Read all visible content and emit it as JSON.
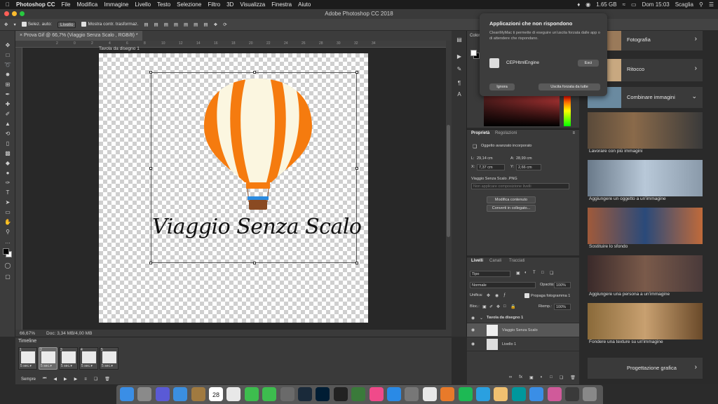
{
  "menubar": {
    "app_name": "Photoshop CC",
    "items": [
      "File",
      "Modifica",
      "Immagine",
      "Livello",
      "Testo",
      "Selezione",
      "Filtro",
      "3D",
      "Visualizza",
      "Finestra",
      "Aiuto"
    ],
    "battery": "1.65 GB",
    "clock": "Dom 15:03",
    "user": "Scaglia"
  },
  "window": {
    "title": "Adobe Photoshop CC 2018"
  },
  "options_bar": {
    "auto_select_label": "Selez. auto:",
    "auto_select_value": "Livello",
    "transform_label": "Mostra contr. trasformaz."
  },
  "document": {
    "tab_title": "Prova Gif @ 66,7% (Viaggio Senza Scalo , RGB/8) *",
    "artboard_label": "Tavola da disegno 1",
    "wordmark": "Viaggio Senza Scalo",
    "zoom": "66,67%",
    "doc_info": "Doc: 3,34 MB/4,00 MB"
  },
  "ruler_marks": [
    "2",
    "0",
    "2",
    "4",
    "6",
    "8",
    "10",
    "12",
    "14",
    "16",
    "18",
    "20",
    "22",
    "24",
    "26",
    "28",
    "30",
    "32",
    "34"
  ],
  "timeline": {
    "title": "Timeline",
    "frames": [
      {
        "num": "1",
        "delay": "5 sec.▾",
        "selected": false
      },
      {
        "num": "2",
        "delay": "5 sec.▾",
        "selected": true
      },
      {
        "num": "3",
        "delay": "5 sec.▾",
        "selected": false
      },
      {
        "num": "4",
        "delay": "5 sec.▾",
        "selected": false
      },
      {
        "num": "5",
        "delay": "5 sec.▾",
        "selected": false
      }
    ],
    "loop": "Sempre"
  },
  "color_panel": {
    "title": "Colore"
  },
  "properties": {
    "tab1": "Proprietà",
    "tab2": "Regolazioni",
    "type_label": "Oggetto avanzato incorporato",
    "l_label": "L:",
    "l_value": "29,14 cm",
    "a_label": "A:",
    "a_value": "28,99 cm",
    "x_label": "X:",
    "x_value": "7,37 cm",
    "y_label": "Y:",
    "y_value": "2,66 cm",
    "file_name": "Viaggio Senza Scalo .PNG",
    "comp_placeholder": "Non applicare composizione livelli",
    "btn_edit": "Modifica contenuto",
    "btn_convert": "Converti in collegato..."
  },
  "layers_panel": {
    "tabs": [
      "Livelli",
      "Canali",
      "Tracciati"
    ],
    "filter_label": "Tipo",
    "blend_mode": "Normale",
    "opacity_label": "Opacità:",
    "opacity_value": "100%",
    "unify_label": "Unifica:",
    "propagate_label": "Propaga fotogramma 1",
    "lock_label": "Bloc.:",
    "fill_label": "Riemp.:",
    "fill_value": "100%",
    "layers": [
      {
        "name": "Tavola da disegno 1",
        "type": "group"
      },
      {
        "name": "Viaggio Senza Scalo",
        "type": "smart",
        "active": true
      },
      {
        "name": "Livello 1",
        "type": "pixel"
      }
    ]
  },
  "learn_panel": {
    "top_rows": [
      "Fotografia",
      "Ritocco"
    ],
    "section_title": "Combinare immagini",
    "cards": [
      "Lavorare con più immagini",
      "Aggiungere un oggetto a un'immagine",
      "Sostituire lo sfondo",
      "Aggiungere una persona a un'immagine",
      "Fondere una texture su un'immagine"
    ],
    "bottom_row": "Progettazione grafica"
  },
  "notification": {
    "title": "Applicazioni che non rispondono",
    "body": "CleanMyMac ti permette di eseguire un'uscita forzata dalle app o di attendere che rispondano.",
    "app_name": "CEPHtmlEngine",
    "btn_quit": "Esci",
    "btn_ignore": "Ignora",
    "btn_force_all": "Uscita forzata da tutte"
  },
  "dock": {
    "calendar_day": "28",
    "apps": [
      {
        "name": "finder",
        "color": "#3a8ee6"
      },
      {
        "name": "launchpad",
        "color": "#8a8a8a"
      },
      {
        "name": "siri",
        "color": "#5a5ad6"
      },
      {
        "name": "mail",
        "color": "#3b8fe0"
      },
      {
        "name": "notes",
        "color": "#a07a40"
      },
      {
        "name": "calendar",
        "color": "#ffffff"
      },
      {
        "name": "photos",
        "color": "#e8e8e8"
      },
      {
        "name": "messages",
        "color": "#3dbd4e"
      },
      {
        "name": "facetime",
        "color": "#3dbd4e"
      },
      {
        "name": "scripteditor",
        "color": "#6a6a6a"
      },
      {
        "name": "lightroom",
        "color": "#1a2a3a"
      },
      {
        "name": "photoshop",
        "color": "#001d34"
      },
      {
        "name": "finalcut",
        "color": "#222"
      },
      {
        "name": "sync",
        "color": "#3a7a3a"
      },
      {
        "name": "itunes",
        "color": "#f04a8a"
      },
      {
        "name": "appstore",
        "color": "#2a8ae6"
      },
      {
        "name": "preferences",
        "color": "#777"
      },
      {
        "name": "chrome",
        "color": "#e8e8e8"
      },
      {
        "name": "firefox",
        "color": "#e87a2a"
      },
      {
        "name": "spotify",
        "color": "#1db954"
      },
      {
        "name": "telegram",
        "color": "#2aa0e0"
      },
      {
        "name": "fontbook",
        "color": "#f0c070"
      },
      {
        "name": "arduino",
        "color": "#00979c"
      },
      {
        "name": "safari",
        "color": "#3a8ee6"
      },
      {
        "name": "cleanmymac",
        "color": "#d05a9a"
      },
      {
        "name": "downloads",
        "color": "#3a3a3a"
      },
      {
        "name": "trash",
        "color": "#888"
      }
    ]
  },
  "colors": {
    "balloon_orange": "#f57b0f",
    "balloon_cream": "#fbf6e0",
    "basket": "#8a4a22",
    "basket_blue": "#2a8ae0"
  }
}
